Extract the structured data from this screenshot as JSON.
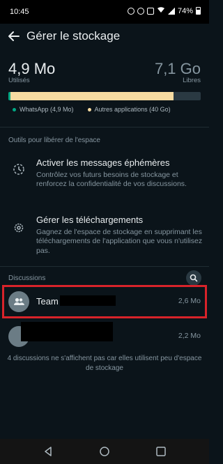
{
  "status": {
    "time": "10:45",
    "battery": "74%"
  },
  "header": {
    "title": "Gérer le stockage"
  },
  "usage": {
    "used_value": "4,9 Mo",
    "used_label": "Utilisés",
    "free_value": "7,1 Go",
    "free_label": "Libres",
    "whatsapp_fraction": 0.01,
    "other_fraction": 0.85,
    "legend": [
      {
        "label": "WhatsApp (4,9 Mo)",
        "color": "#00a884"
      },
      {
        "label": "Autres applications (40 Go)",
        "color": "#f7dba1"
      }
    ]
  },
  "tools": {
    "heading": "Outils pour libérer de l'espace",
    "items": [
      {
        "title": "Activer les messages éphémères",
        "description": "Contrôlez vos futurs besoins de stockage et renforcez la confidentialité de vos discussions.",
        "icon": "timer-icon"
      },
      {
        "title": "Gérer les téléchargements",
        "description": "Gagnez de l'espace de stockage en supprimant les téléchargements de l'application que vous n'utilisez pas.",
        "icon": "gear-icon"
      }
    ]
  },
  "discussions": {
    "heading": "Discussions",
    "items": [
      {
        "name": "Team",
        "size": "2,6 Mo"
      },
      {
        "name": "",
        "size": "2,2 Mo"
      }
    ],
    "footnote": "4 discussions ne s'affichent pas car elles utilisent peu d'espace de stockage"
  },
  "colors": {
    "background": "#0b141a",
    "accent": "#00a884",
    "highlight": "#d8232a"
  }
}
